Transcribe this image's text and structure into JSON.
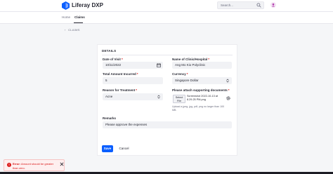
{
  "header": {
    "site_title": "Liferay DXP",
    "search_placeholder": "Search...",
    "logo_icon": "liferay-logo",
    "user_icon": "user-avatar-icon"
  },
  "nav": {
    "items": [
      {
        "label": "Home",
        "active": false
      },
      {
        "label": "Claims",
        "active": true
      }
    ]
  },
  "breadcrumb": {
    "back_symbol": "‹",
    "label": "CLAIMS"
  },
  "form": {
    "section_title": "DETAILS",
    "fields": {
      "date_of_visit": {
        "label": "Date of Visit",
        "required": "*",
        "value": "10/11/2022",
        "icon": "calendar-icon"
      },
      "clinic_name": {
        "label": "Name of Clinic/Hospital",
        "required": "*",
        "value": "Ang Mo Kio Polyclinic"
      },
      "total_amount": {
        "label": "Total Amount Incurred",
        "required": "*",
        "value": "5"
      },
      "currency": {
        "label": "Currency",
        "required": "*",
        "value": "Singapore Dollar",
        "icon": "caret-double-icon"
      },
      "reason": {
        "label": "Reason for Treatment",
        "required": "*",
        "value": "Acne",
        "icon": "caret-double-icon"
      },
      "documents": {
        "label": "Please attach supporting documents",
        "required": "*",
        "button_label": "Select File",
        "file_name": "Screenshot 2022-10-13 at 8.29.25 PM.png",
        "help_text": "Upload a jpeg, jpg, pdf, png no larger than 100 MB.",
        "icon": "gear-icon"
      },
      "remarks": {
        "label": "Remarks",
        "value": "Please approve the expenses"
      }
    },
    "save_label": "Save",
    "cancel_label": "Cancel"
  },
  "toast": {
    "title": "Error:",
    "message": "Amount should be greater than zero.",
    "icon": "exclamation-circle-icon",
    "close_icon": "close-icon"
  },
  "colors": {
    "primary": "#0b5fff",
    "error": "#da1414",
    "field_bg": "#f1f2f5"
  }
}
